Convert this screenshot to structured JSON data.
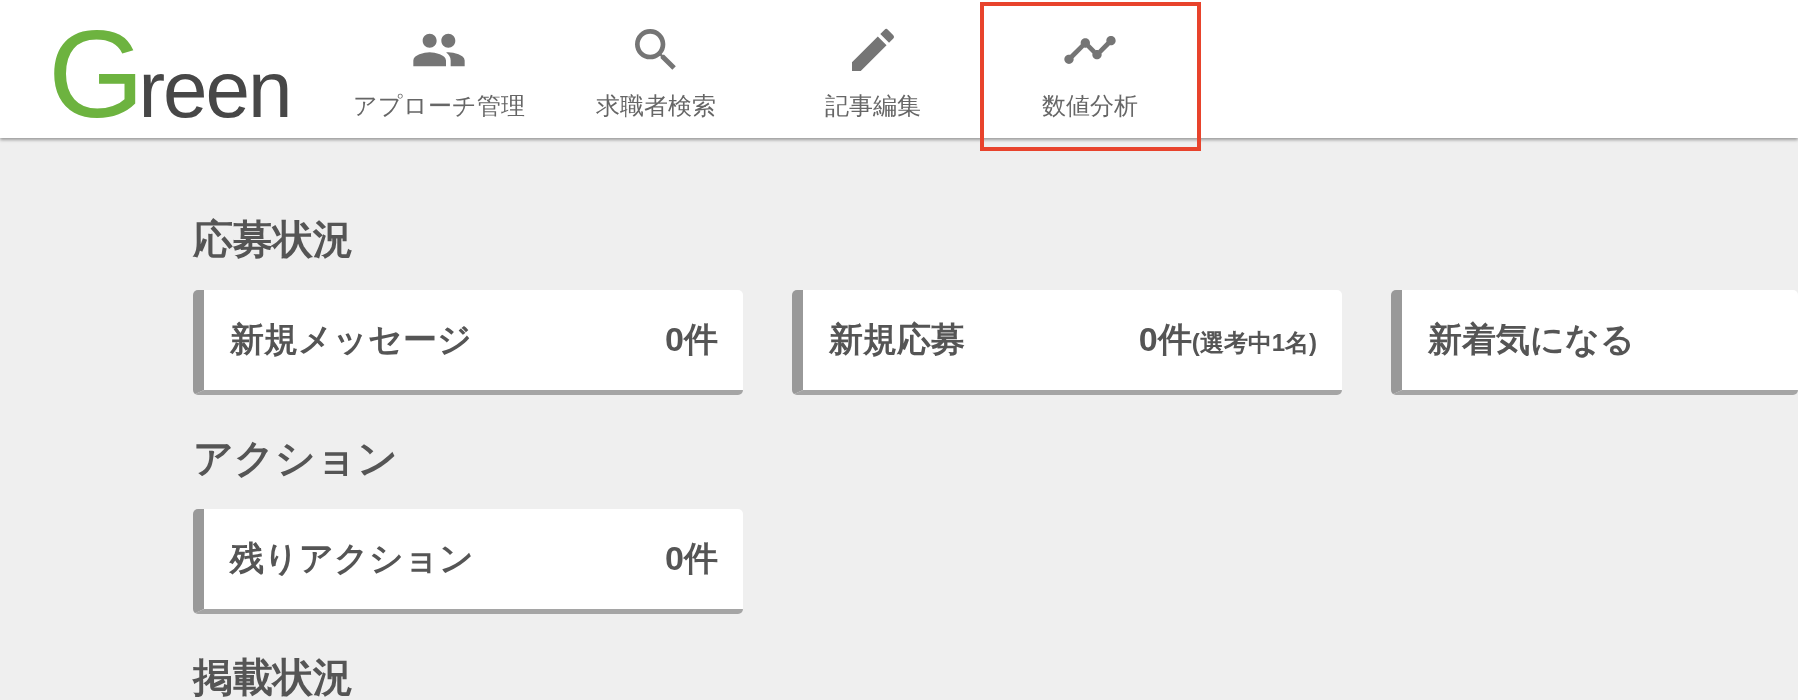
{
  "logo": "Green",
  "nav": [
    {
      "label": "アプローチ管理",
      "highlighted": false
    },
    {
      "label": "求職者検索",
      "highlighted": false
    },
    {
      "label": "記事編集",
      "highlighted": false
    },
    {
      "label": "数値分析",
      "highlighted": true
    }
  ],
  "sections": [
    {
      "title": "応募状況",
      "cards": [
        {
          "label": "新規メッセージ",
          "count": "0件"
        },
        {
          "label": "新規応募",
          "count": "0件",
          "note": "(選考中1名)"
        },
        {
          "label": "新着気になる"
        }
      ]
    },
    {
      "title": "アクション",
      "cards": [
        {
          "label": "残りアクション",
          "count": "0件"
        }
      ]
    },
    {
      "title": "掲載状況"
    }
  ]
}
